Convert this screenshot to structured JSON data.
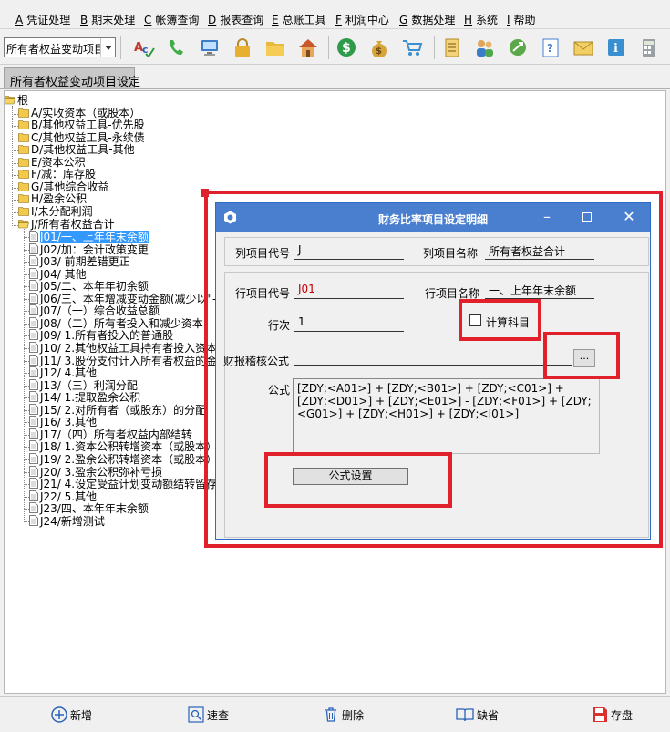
{
  "menu": [
    {
      "key": "A",
      "label": "凭证处理"
    },
    {
      "key": "B",
      "label": "期末处理"
    },
    {
      "key": "C",
      "label": "帐簿查询"
    },
    {
      "key": "D",
      "label": "报表查询"
    },
    {
      "key": "E",
      "label": "总账工具"
    },
    {
      "key": "F",
      "label": "利润中心"
    },
    {
      "key": "G",
      "label": "数据处理"
    },
    {
      "key": "H",
      "label": "系统"
    },
    {
      "key": "I",
      "label": "帮助"
    }
  ],
  "toolbar": {
    "combo_value": "所有者权益变动项目",
    "icons": [
      "spellcheck-icon",
      "phone-icon",
      "computer-icon",
      "lock-icon",
      "folder-icon",
      "home-icon",
      "dollar-icon",
      "money-bag-icon",
      "cart-icon",
      "list-icon",
      "users-icon",
      "link-icon",
      "help-doc-icon",
      "mail-icon",
      "info-icon",
      "calculator-icon"
    ]
  },
  "tab": {
    "label": "所有者权益变动项目设定"
  },
  "tree": {
    "root": "根",
    "top_nodes": [
      "A/实收资本（或股本）",
      "B/其他权益工具-优先股",
      "C/其他权益工具-永续债",
      "D/其他权益工具-其他",
      "E/资本公积",
      "F/减：库存股",
      "G/其他综合收益",
      "H/盈余公积",
      "I/未分配利润",
      "J/所有者权益合计"
    ],
    "j_children": [
      "J01/一、上年年末余额",
      "J02/加：会计政策变更",
      "J03/      前期差错更正",
      "J04/      其他",
      "J05/二、本年年初余额",
      "J06/三、本年增减变动金额(减少以\"-\"",
      "J07/（一）综合收益总额",
      "J08/（二）所有者投入和减少资本",
      "J09/    1.所有者投入的普通股",
      "J10/    2.其他权益工具持有者投入资本",
      "J11/    3.股份支付计入所有者权益的金额",
      "J12/    4.其他",
      "J13/（三）利润分配",
      "J14/    1.提取盈余公积",
      "J15/    2.对所有者（或股东）的分配",
      "J16/    3.其他",
      "J17/（四）所有者权益内部结转",
      "J18/    1.资本公积转增资本（或股本）",
      "J19/    2.盈余公积转增资本（或股本）",
      "J20/    3.盈余公积弥补亏损",
      "J21/    4.设定受益计划变动额结转留存收益",
      "J22/    5.其他",
      "J23/四、本年年末余额",
      "J24/新增测试"
    ]
  },
  "dialog": {
    "title": "财务比率项目设定明细",
    "col_code_label": "列项目代号",
    "col_code": "J",
    "col_name_label": "列项目名称",
    "col_name": "所有者权益合计",
    "row_code_label": "行项目代号",
    "row_code": "J01",
    "row_name_label": "行项目名称",
    "row_name": "一、上年年末余额",
    "row_order_label": "行次",
    "row_order": "1",
    "calc_subject_label": "计算科目",
    "audit_formula_label": "财报稽核公式",
    "audit_formula": "",
    "browse_label": "...",
    "formula_label": "公式",
    "formula": "[ZDY;<A01>] + [ZDY;<B01>] + [ZDY;<C01>] + [ZDY;<D01>] + [ZDY;<E01>] - [ZDY;<F01>] + [ZDY;<G01>] + [ZDY;<H01>] + [ZDY;<I01>]",
    "formula_button": "公式设置"
  },
  "bottom": {
    "add": "新增",
    "find": "速查",
    "delete": "删除",
    "default": "缺省",
    "save": "存盘"
  },
  "colors": {
    "annotation_red": "#e0202a",
    "title_blue": "#4a7fcf",
    "selection_blue": "#3399ff"
  }
}
